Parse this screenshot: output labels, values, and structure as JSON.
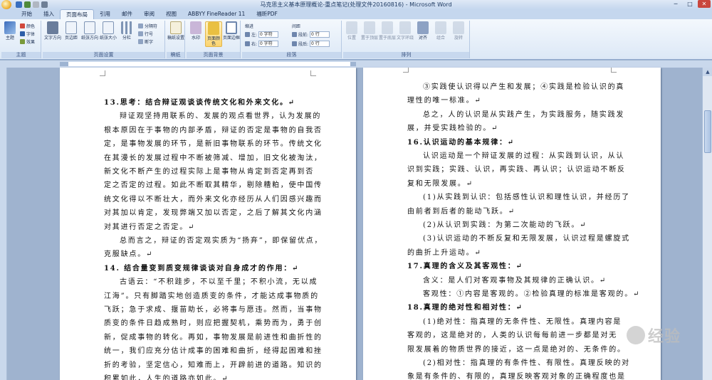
{
  "window": {
    "title": "马克思主义基本原理概论-重点笔记(处理文件20160816) - Microsoft Word",
    "controls": [
      "─",
      "□",
      "✕"
    ]
  },
  "tabs": [
    "开始",
    "插入",
    "页面布局",
    "引用",
    "邮件",
    "审阅",
    "视图",
    "ABBYY FineReader 11",
    "福昕PDF"
  ],
  "active_tab": "页面布局",
  "ribbon": {
    "theme": {
      "label": "主题",
      "btn": "主题",
      "colors": "颜色",
      "fonts": "字体",
      "effects": "效果"
    },
    "page_setup": {
      "label": "页面设置",
      "buttons": [
        "文字方向",
        "页边距",
        "纸张方向",
        "纸张大小",
        "分栏"
      ],
      "small": [
        "分隔符",
        "行号",
        "断字"
      ]
    },
    "draft": {
      "label": "稿纸",
      "btn": "稿纸设置"
    },
    "page_bg": {
      "label": "页面背景",
      "buttons": [
        "水印",
        "页面颜色",
        "页面边框"
      ]
    },
    "paragraph": {
      "label": "段落",
      "indent_title": "缩进",
      "spacing_title": "间距",
      "indent_left_label": "左:",
      "indent_left": "0 字符",
      "indent_right_label": "右:",
      "indent_right": "0 字符",
      "space_before_label": "段前:",
      "space_before": "0 行",
      "space_after_label": "段后:",
      "space_after": "0 行"
    },
    "arrange": {
      "label": "排列",
      "buttons": [
        "位置",
        "置于顶层",
        "置于底层",
        "文字环绕",
        "对齐",
        "组合",
        "旋转"
      ]
    }
  },
  "page1": [
    {
      "text": "13.思考：结合辩证观谈谈传统文化和外来文化。↵",
      "bold": true
    },
    {
      "text": "辩证观坚持用联系的、发展的观点看世界，认为发展的",
      "bold": false
    },
    {
      "text": "根本原因在于事物的内部矛盾，辩证的否定是事物的自我否",
      "bold": false
    },
    {
      "text": "定，是事物发展的环节，是新旧事物联系的环节。传统文化",
      "bold": false
    },
    {
      "text": "在其漫长的发展过程中不断被筛减、增加，旧文化被淘汰，",
      "bold": false
    },
    {
      "text": "新文化不断产生的过程实际上是事物从肯定到否定再到否",
      "bold": false
    },
    {
      "text": "定之否定的过程。如此不断取其精华，剔除糟粕，使中国传",
      "bold": false
    },
    {
      "text": "统文化得以不断壮大，而外来文化亦经历从人们因感兴趣而",
      "bold": false
    },
    {
      "text": "对其加以肯定，发现弊端又加以否定，之后了解其文化内涵",
      "bold": false
    },
    {
      "text": "对其进行否定之否定。↵",
      "bold": false
    },
    {
      "text": "总而言之，辩证的否定观实质为“扬弃”，即保留优点，",
      "bold": false
    },
    {
      "text": "克服缺点。↵",
      "bold": false
    },
    {
      "text": "14.   结合量变到质变规律谈谈对自身成才的作用：↵",
      "bold": true
    },
    {
      "text": "古语云：“不积跬步，不以至千里；不积小流，无以成",
      "bold": false
    },
    {
      "text": "江海”。只有脚踏实地创造质变的条件，才能达成事物质的",
      "bold": false
    },
    {
      "text": "飞跃；急于求成、揠苗助长，必将事与愿违。然而，当事物",
      "bold": false
    },
    {
      "text": "质变的条件日趋成熟时，则应把握契机，乘势而为，勇于创",
      "bold": false
    },
    {
      "text": "新，促成事物的转化。再如，事物发展是前进性和曲折性的",
      "bold": false
    },
    {
      "text": "统一，我们应充分估计成事的困难和曲折，经得起困难和挫",
      "bold": false
    },
    {
      "text": "折的考验，坚定信心，知难而上，开辟前进的道路。知识的",
      "bold": false
    },
    {
      "text": "积累如此，人生的道路亦如此。↵",
      "bold": false
    }
  ],
  "page2": [
    {
      "text": "③实践使认识得以产生和发展；④实践是检验认识的真",
      "bold": false
    },
    {
      "text": "理性的唯一标准。↵",
      "bold": false
    },
    {
      "text": "总之，人的认识是从实践产生，为实践服务，随实践发",
      "bold": false
    },
    {
      "text": "展，并受实践检验的。↵",
      "bold": false
    },
    {
      "text": "16.认识运动的基本规律：↵",
      "bold": true
    },
    {
      "text": "认识运动是一个辩证发展的过程：从实践到认识，从认",
      "bold": false
    },
    {
      "text": "识到实践；实践、认识，再实践、再认识；认识运动不断反",
      "bold": false
    },
    {
      "text": "复和无限发展。↵",
      "bold": false
    },
    {
      "text": "(1)从实践到认识：包括感性认识和理性认识，并经历了",
      "bold": false
    },
    {
      "text": "由前者到后者的能动飞跃。↵",
      "bold": false
    },
    {
      "text": "(2)从认识到实践：为第二次能动的飞跃。↵",
      "bold": false
    },
    {
      "text": "(3)认识运动的不断反复和无限发展，认识过程是螺旋式",
      "bold": false
    },
    {
      "text": "的曲折上升运动。↵",
      "bold": false
    },
    {
      "text": "17.真理的含义及其客观性：↵",
      "bold": true
    },
    {
      "text": "含义：是人们对客观事物及其规律的正确认识。↵",
      "bold": false
    },
    {
      "text": "客观性：①内容是客观的。②检验真理的标准是客观的。↵",
      "bold": false
    },
    {
      "text": "18.真理的绝对性和相对性：↵",
      "bold": true
    },
    {
      "text": "(1)绝对性：指真理的无条件性、无限性。真理内容是",
      "bold": false
    },
    {
      "text": "客观的，这是绝对的，人类的认识每每前进一步都是对无",
      "bold": false
    },
    {
      "text": "限发展着的物质世界的接近，这一点是绝对的、无条件的。",
      "bold": false
    },
    {
      "text": "(2)相对性：指真理的有条件性、有限性。真理反映的对",
      "bold": false
    },
    {
      "text": "象是有条件的、有限的，真理反映客观对象的正确程度也是",
      "bold": false
    }
  ],
  "watermark": {
    "text": "经验"
  },
  "colors": {
    "ribbon_bg": "#dce8f6",
    "workspace": "#9fb3cf",
    "close_btn": "#c9463d"
  }
}
